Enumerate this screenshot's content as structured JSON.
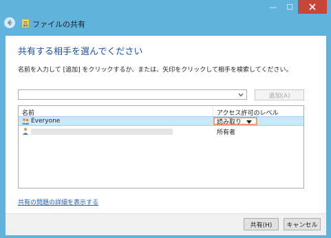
{
  "window": {
    "title": "ファイルの共有",
    "controls": {
      "minimize": "—",
      "maximize": "☐",
      "close": "✕"
    }
  },
  "heading": "共有する相手を選んでください",
  "instruction": "名前を入力して [追加] をクリックするか、または、矢印をクリックして相手を検索してください。",
  "picker": {
    "value": "",
    "add_label": "追加(A)"
  },
  "list": {
    "columns": [
      "名前",
      "アクセス許可のレベル"
    ],
    "rows": [
      {
        "name": "Everyone",
        "level": "読み取り",
        "selected": true
      },
      {
        "name": "",
        "level": "所有者",
        "selected": false
      }
    ]
  },
  "link_text": "共有の問題の詳細を表示する",
  "buttons": {
    "share": "共有(H)",
    "cancel": "キャンセル"
  },
  "colors": {
    "frame": "#5fb3dc",
    "heading": "#1a4f9f",
    "selection": "#cce8ff",
    "highlight_border": "#f19b71",
    "link": "#1a5fb4"
  }
}
